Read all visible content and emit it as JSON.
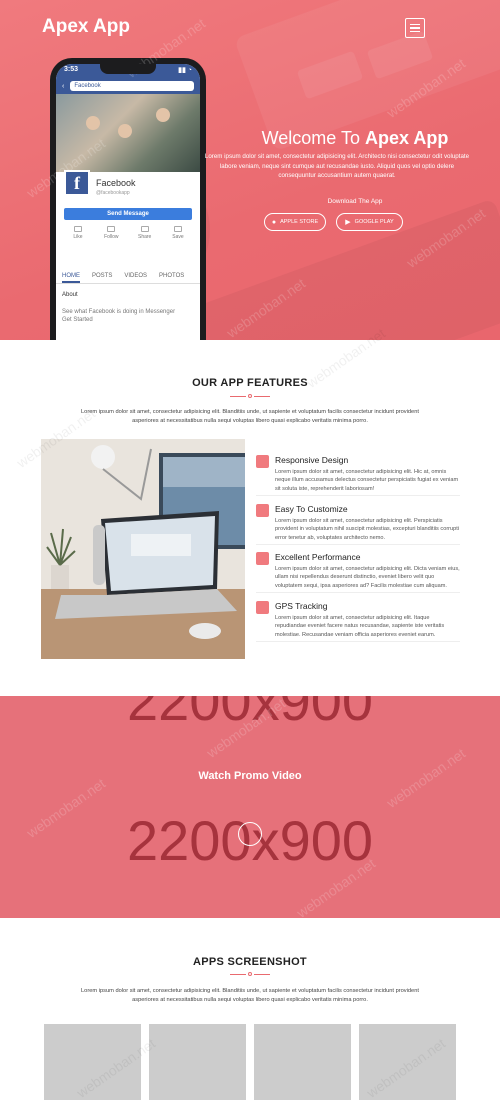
{
  "brand": "Apex App",
  "phone": {
    "time": "3:53",
    "search": "Facebook",
    "page_name": "Facebook",
    "handle": "@facebookapp",
    "send_label": "Send Message",
    "actions": [
      "Like",
      "Follow",
      "Share",
      "Save"
    ],
    "tabs": [
      "HOME",
      "POSTS",
      "VIDEOS",
      "PHOTOS"
    ],
    "about": "About",
    "message": "See what Facebook is doing in Messenger",
    "message_cta": "Get Started"
  },
  "hero": {
    "title_prefix": "Welcome To ",
    "title_brand": "Apex App",
    "description": "Lorem ipsum dolor sit amet, consectetur adipisicing elit. Architecto nisi consectetur odit voluptate labore veniam, neque sint cumque aut recusandae iusto. Aliquid quos vel optio delere consequuntur accusantium autem quaerat.",
    "download_label": "Download The App",
    "apple_label": "APPLE STORE",
    "google_label": "GOOGLE PLAY"
  },
  "features": {
    "title": "OUR APP FEATURES",
    "description": "Lorem ipsum dolor sit amet, consectetur adipisicing elit. Blanditiis unde, ut sapiente et voluptatum facilis consectetur incidunt provident asperiores at necessitatibus nulla sequi voluptas libero quasi explicabo veritatis minima porro.",
    "items": [
      {
        "title": "Responsive Design",
        "text": "Lorem ipsum dolor sit amet, consectetur adipisicing elit. Hic at, omnis neque illum accusamus delectus consectetur perspiciatis fugiat ex veniam sit soluta iste, reprehenderit laboriosam!"
      },
      {
        "title": "Easy To Customize",
        "text": "Lorem ipsum dolor sit amet, consectetur adipisicing elit. Perspiciatis provident in voluptatum nihil suscipit molestias, excepturi blanditiis corrupti error tenetur ab, voluptates architecto nemo."
      },
      {
        "title": "Excellent Performance",
        "text": "Lorem ipsum dolor sit amet, consectetur adipisicing elit. Dicta veniam eius, ullam nisi repellendus deserunt distinctio, eveniet libero velit quo voluptatem sequi, ipsa asperiores ad? Facilis molestiae cum aliquam."
      },
      {
        "title": "GPS Tracking",
        "text": "Lorem ipsum dolor sit amet, consectetur adipisicing elit. Itaque repudiandae eveniet facere natus recusandae, sapiente iste veritatis molestiae. Recusandae veniam officia asperiores eveniet earum."
      }
    ]
  },
  "promo": {
    "title": "Watch Promo Video",
    "placeholder": "2200x900"
  },
  "screenshots": {
    "title": "APPS SCREENSHOT",
    "description": "Lorem ipsum dolor sit amet, consectetur adipisicing elit. Blanditiis unde, ut sapiente et voluptatum facilis consectetur incidunt provident asperiores at necessitatibus nulla sequi voluptas libero quasi explicabo veritatis minima porro."
  },
  "watermark": "webmoban.net",
  "colors": {
    "accent": "#e96a6f",
    "hero": "#ee7378",
    "promo": "#e6717a"
  }
}
